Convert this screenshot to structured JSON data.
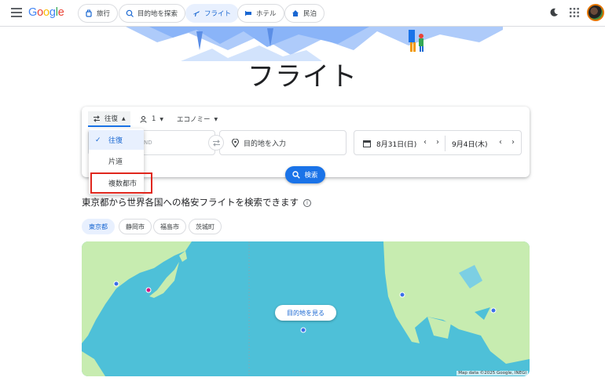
{
  "header": {
    "logo": [
      "G",
      "o",
      "o",
      "g",
      "l",
      "e"
    ],
    "tabs": [
      {
        "label": "旅行",
        "icon": "travel-bag-icon"
      },
      {
        "label": "目的地を探索",
        "icon": "explore-icon"
      },
      {
        "label": "フライト",
        "icon": "flight-icon",
        "active": true
      },
      {
        "label": "ホテル",
        "icon": "hotel-icon"
      },
      {
        "label": "民泊",
        "icon": "vacation-rental-icon"
      }
    ]
  },
  "page_title": "フライト",
  "search": {
    "trip_type": "往復",
    "passengers": "1",
    "cabin_class": "エコノミー",
    "from_value": "ND",
    "to_placeholder": "目的地を入力",
    "depart_date": "8月31日(日)",
    "return_date": "9月4日(木)",
    "search_label": "検索"
  },
  "trip_dropdown": {
    "items": [
      {
        "label": "往復",
        "selected": true
      },
      {
        "label": "片道",
        "selected": false
      },
      {
        "label": "複数都市",
        "selected": false
      }
    ]
  },
  "explore": {
    "title": "東京都から世界各国への格安フライトを検索できます",
    "chips": [
      "東京都",
      "静岡市",
      "福島市",
      "茨城町"
    ],
    "map_button": "目的地を見る",
    "map_attribution": "Map data ©2025 Google, INEGI"
  },
  "colors": {
    "accent": "#1a73e8",
    "highlight": "#e0271d",
    "map_water": "#4ec0d8",
    "map_land": "#c7ecb0"
  }
}
